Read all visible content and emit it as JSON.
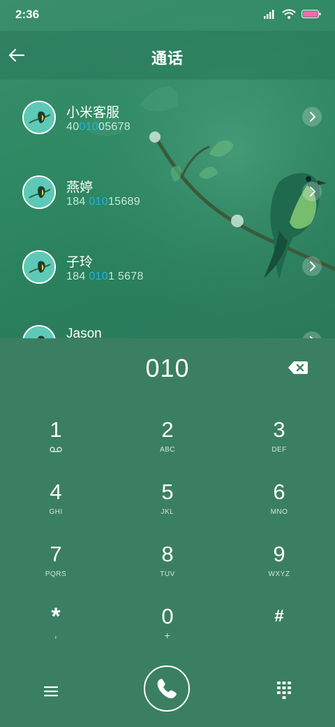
{
  "status_bar": {
    "time": "2:36"
  },
  "header": {
    "title": "通话"
  },
  "contacts": [
    {
      "name": "小米客服",
      "number_pre": "40",
      "number_match": "010",
      "number_post": "05678"
    },
    {
      "name": "燕婷",
      "number_pre": "184 ",
      "number_match": "010",
      "number_post": "15689"
    },
    {
      "name": "子玲",
      "number_pre": "184 ",
      "number_match": "010",
      "number_post": "1 5678"
    },
    {
      "name": "Jason",
      "number_pre": "",
      "number_match": "",
      "number_post": ""
    }
  ],
  "dialer": {
    "input": "010",
    "keys": [
      {
        "digit": "1",
        "letters": ""
      },
      {
        "digit": "2",
        "letters": "ABC"
      },
      {
        "digit": "3",
        "letters": "DEF"
      },
      {
        "digit": "4",
        "letters": "GHI"
      },
      {
        "digit": "5",
        "letters": "JKL"
      },
      {
        "digit": "6",
        "letters": "MNO"
      },
      {
        "digit": "7",
        "letters": "PQRS"
      },
      {
        "digit": "8",
        "letters": "TUV"
      },
      {
        "digit": "9",
        "letters": "WXYZ"
      },
      {
        "digit": "*",
        "letters": ","
      },
      {
        "digit": "0",
        "letters": "+"
      },
      {
        "digit": "#",
        "letters": ""
      }
    ]
  },
  "icons": {
    "back": "arrow-left-icon",
    "backspace": "backspace-icon",
    "voicemail": "voicemail-icon",
    "menu": "hamburger-menu-icon",
    "call": "phone-icon",
    "keypad": "keypad-icon",
    "chevron": "chevron-right-icon"
  },
  "colors": {
    "background": "#3b7f62",
    "match_highlight": "#1fb4e6",
    "battery": "#f06ab0"
  }
}
